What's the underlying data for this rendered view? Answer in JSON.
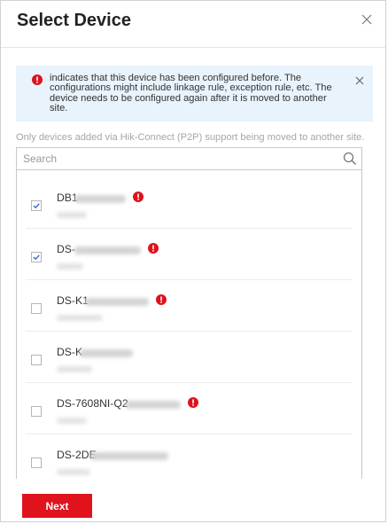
{
  "dialog": {
    "title": "Select Device",
    "close_icon": "close-icon"
  },
  "alert": {
    "icon": "info-error-icon",
    "text": "indicates that this device has been configured before. The configurations might include linkage rule, exception rule, etc. The device needs to be configured again after it is moved to another site.",
    "close_icon": "close-icon"
  },
  "hint": "Only devices added via Hik-Connect (P2P) support being moved to another site.",
  "search": {
    "placeholder": "Search",
    "value": "",
    "icon": "search-icon"
  },
  "devices": [
    {
      "name": "DB1",
      "checked": true,
      "configured": true
    },
    {
      "name": "DS-",
      "checked": true,
      "configured": true
    },
    {
      "name": "DS-K1",
      "checked": false,
      "configured": true
    },
    {
      "name": "DS-K",
      "checked": false,
      "configured": false
    },
    {
      "name": "DS-7608NI-Q2",
      "checked": false,
      "configured": true
    },
    {
      "name": "DS-2DE",
      "checked": false,
      "configured": false
    }
  ],
  "footer": {
    "next_label": "Next"
  },
  "colors": {
    "accent": "#e0121c",
    "alert_bg": "#e8f3fb",
    "checkmark": "#3a6ad1"
  }
}
